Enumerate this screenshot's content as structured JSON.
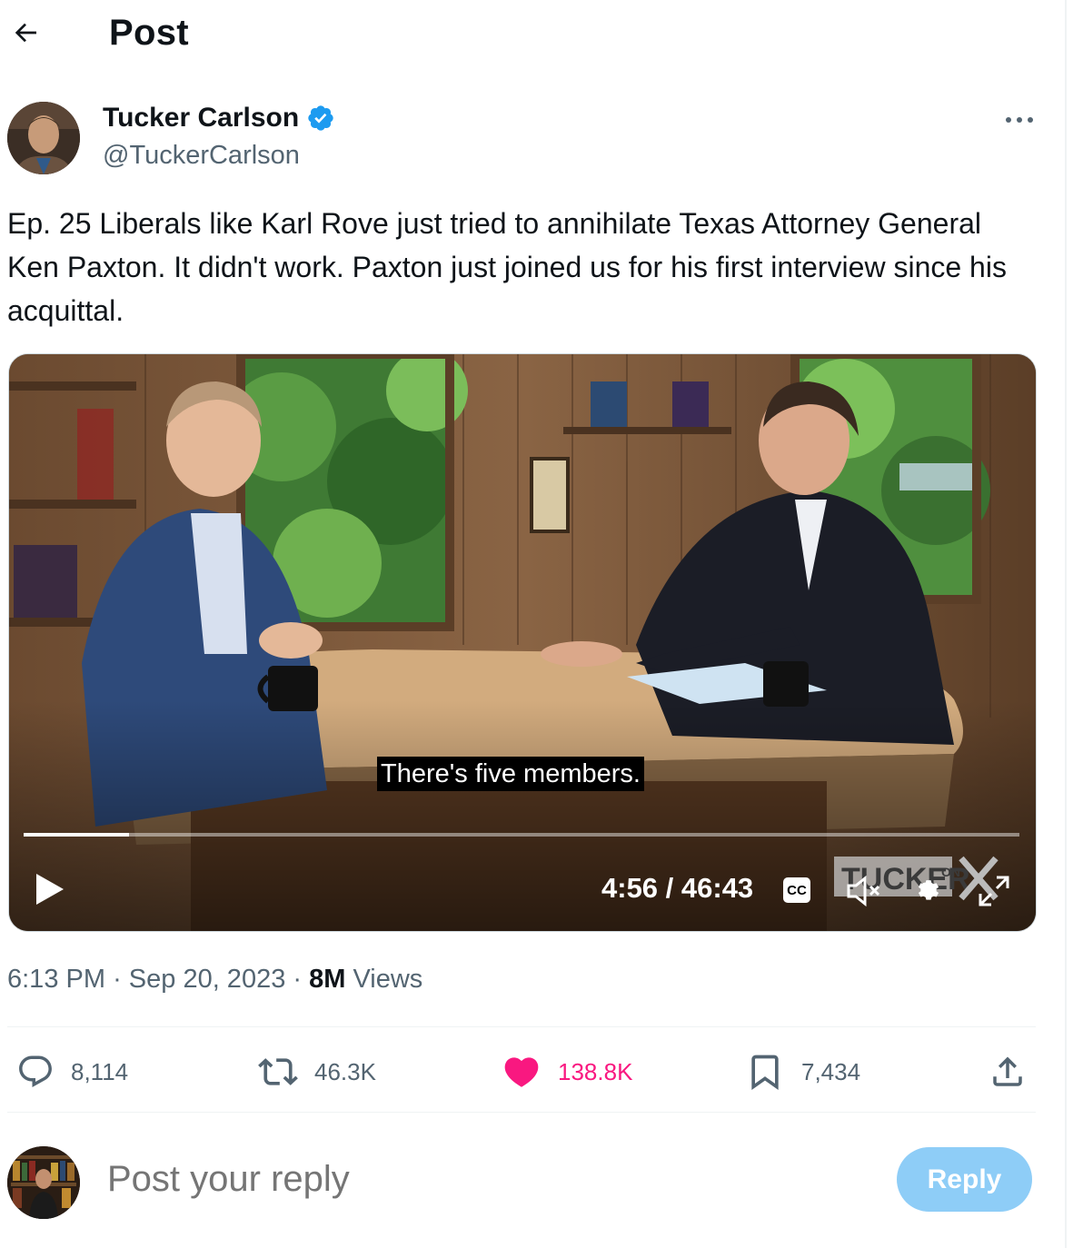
{
  "header": {
    "title": "Post"
  },
  "author": {
    "name": "Tucker Carlson",
    "handle": "@TuckerCarlson",
    "verified": true
  },
  "post": {
    "text": "Ep. 25  Liberals like Karl Rove just tried to annihilate Texas Attorney General Ken Paxton. It didn't work. Paxton just joined us for his first interview since his acquittal."
  },
  "video": {
    "caption": "There's five members.",
    "time": "4:56 / 46:43",
    "cc_label": "CC",
    "progress": 0.106,
    "logo_text": "TUCKER ON X"
  },
  "meta": {
    "time": "6:13 PM",
    "date": "Sep 20, 2023",
    "views_count": "8M",
    "views_label": "Views"
  },
  "actions": {
    "replies": "8,114",
    "reposts": "46.3K",
    "likes": "138.8K",
    "bookmarks": "7,434"
  },
  "reply": {
    "placeholder": "Post your reply",
    "button": "Reply"
  },
  "colors": {
    "like": "#f91880",
    "verified": "#1d9bf0",
    "reply_button": "#8ecdf7"
  }
}
